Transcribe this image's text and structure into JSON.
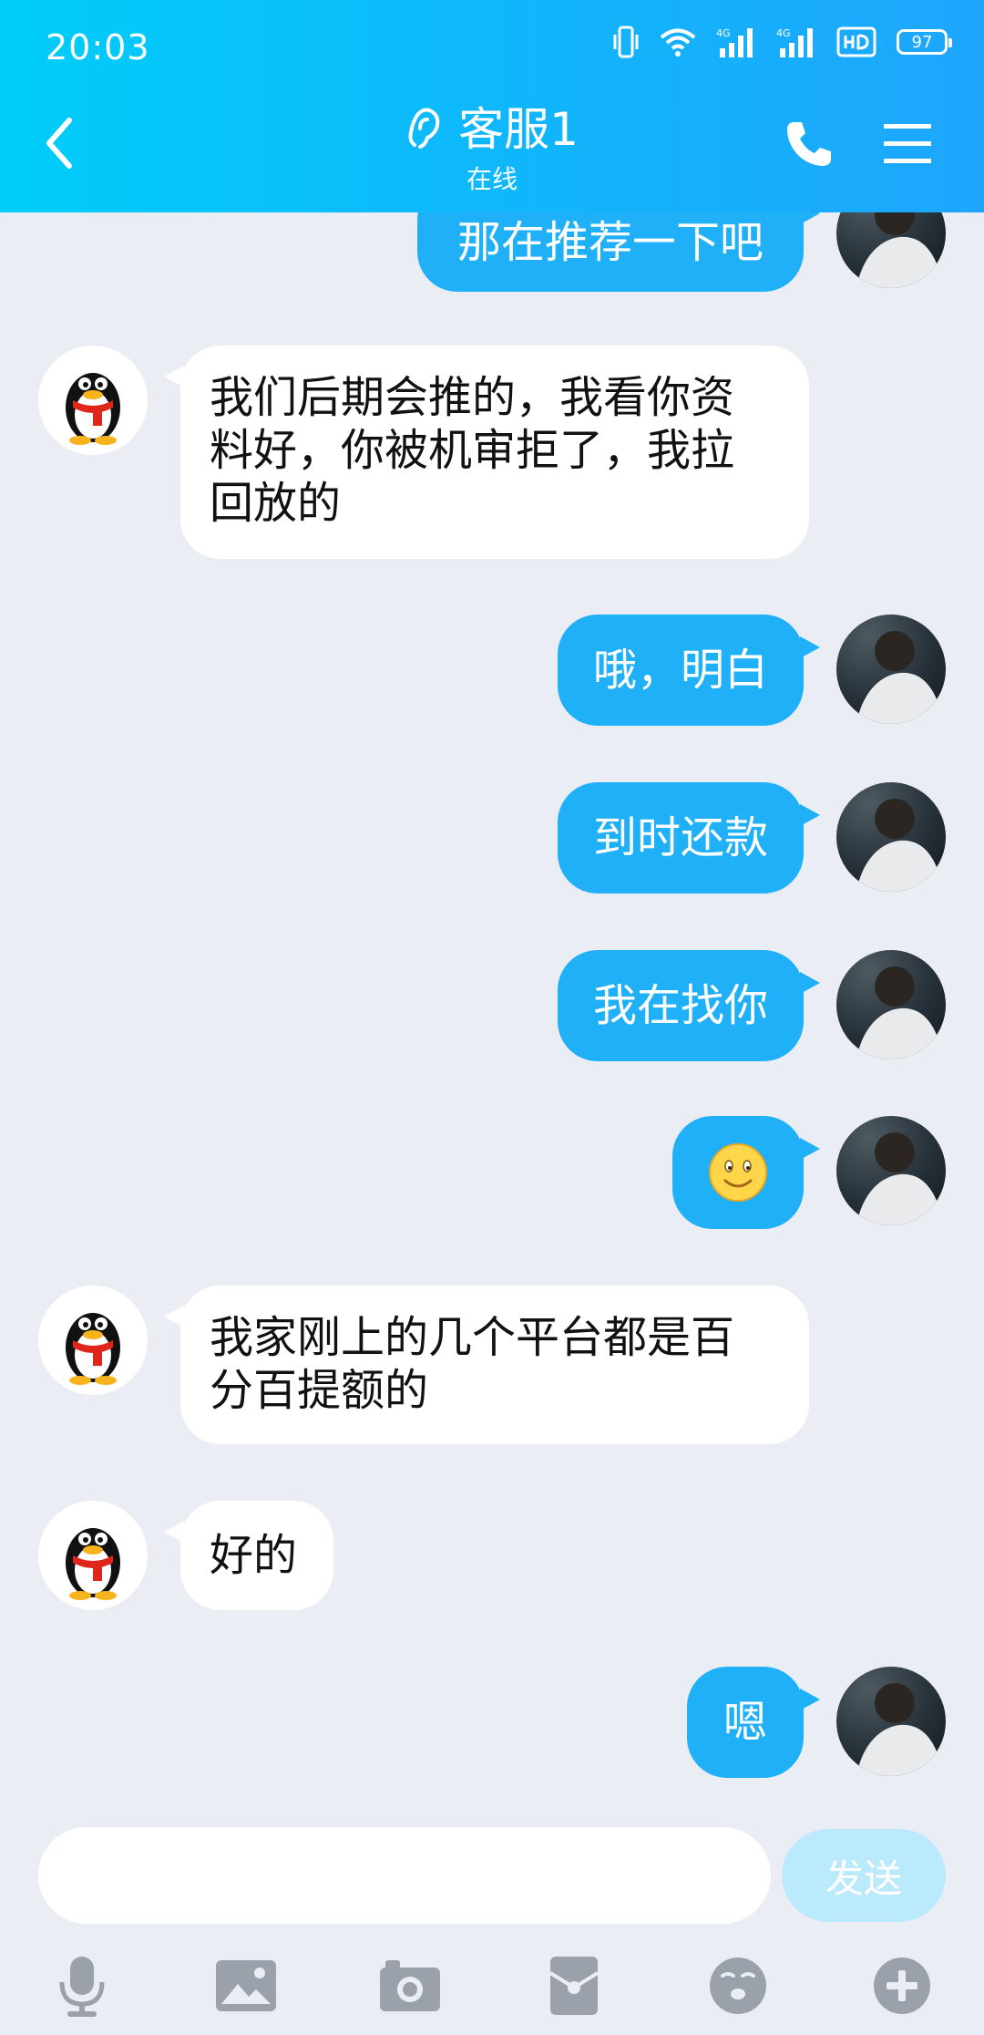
{
  "status_bar": {
    "time": "20:03",
    "battery": "97",
    "net1": "4G",
    "net2": "4G"
  },
  "header": {
    "name": "客服1",
    "status": "在线",
    "icons": [
      "back-arrow-icon",
      "ear-icon",
      "phone-icon",
      "menu-icon"
    ]
  },
  "messages": [
    {
      "from": "me",
      "text": "那在推荐一下吧"
    },
    {
      "from": "other",
      "lines": [
        "我们后期会推的，我看你资",
        "料好，你被机审拒了，我拉",
        "回放的"
      ]
    },
    {
      "from": "me",
      "text": "哦，明白"
    },
    {
      "from": "me",
      "text": "到时还款"
    },
    {
      "from": "me",
      "text": "我在找你"
    },
    {
      "from": "me",
      "emoji": "smile-emoji"
    },
    {
      "from": "other",
      "lines": [
        "我家刚上的几个平台都是百",
        "分百提额的"
      ]
    },
    {
      "from": "other",
      "lines": [
        "好的"
      ]
    },
    {
      "from": "me",
      "text": "嗯"
    }
  ],
  "input": {
    "placeholder": "",
    "value": "",
    "send_label": "发送"
  },
  "toolbar": [
    "microphone-icon",
    "image-icon",
    "camera-icon",
    "red-packet-icon",
    "emoji-icon",
    "plus-icon"
  ],
  "colors": {
    "header_start": "#00cdf9",
    "header_end": "#1ea6fc",
    "bubble_out": "#1fb0f8",
    "background": "#ebedf5"
  }
}
